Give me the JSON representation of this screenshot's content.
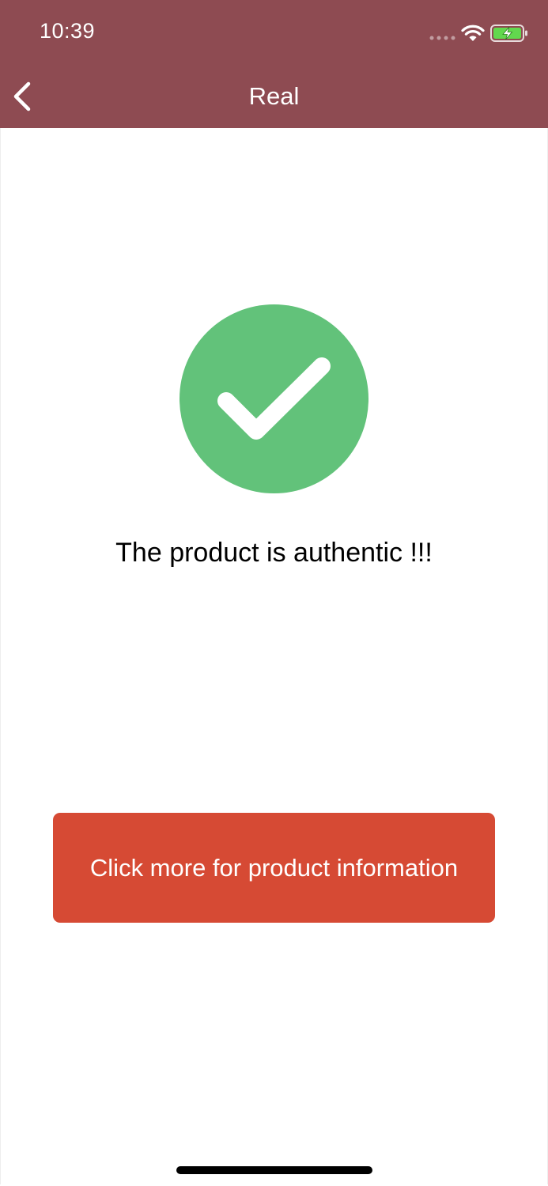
{
  "status_bar": {
    "time": "10:39"
  },
  "nav": {
    "title": "Real",
    "back_icon": "chevron-left-icon"
  },
  "result": {
    "icon": "checkmark-circle-icon",
    "message": "The product is authentic !!!"
  },
  "actions": {
    "info_button_label": "Click more for product information"
  },
  "colors": {
    "header_background": "#8E4B52",
    "success_green": "#62C27A",
    "button_background": "#D64A34",
    "text_primary": "#000000",
    "battery_green": "#62D84E"
  }
}
